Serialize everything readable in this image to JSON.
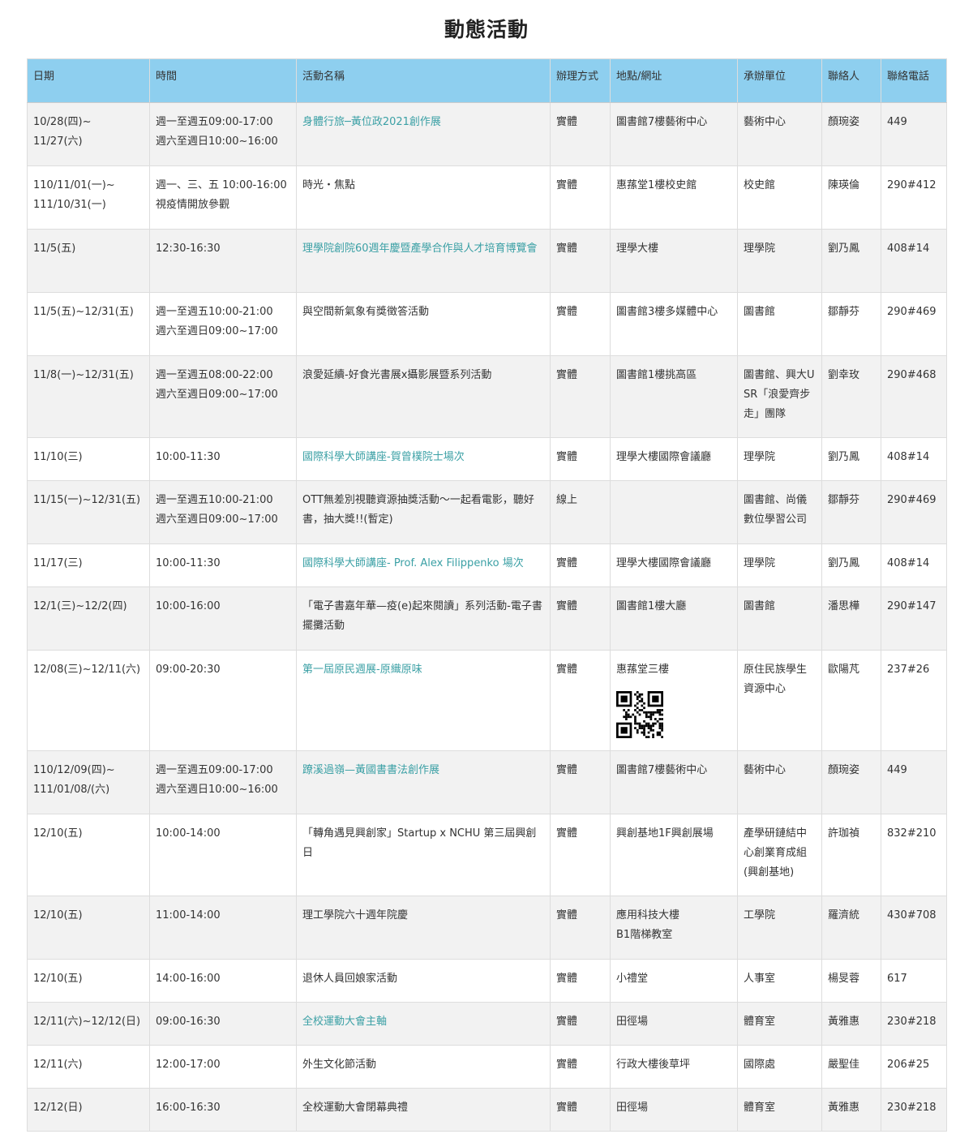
{
  "page": {
    "title": "動態活動"
  },
  "table": {
    "headers": [
      "日期",
      "時間",
      "活動名稱",
      "辦理方式",
      "地點/網址",
      "承辦單位",
      "聯絡人",
      "聯絡電話"
    ],
    "rows": [
      {
        "date": [
          "10/28(四)~",
          "11/27(六)"
        ],
        "time": [
          "週一至週五09:00-17:00",
          "週六至週日10:00~16:00"
        ],
        "name": "身體行旅─黃位政2021創作展",
        "link": true,
        "mode": "實體",
        "place": [
          "圖書館7樓藝術中心"
        ],
        "unit": "藝術中心",
        "contact": "顏琬姿",
        "phone": "449"
      },
      {
        "date": [
          "110/11/01(一)~",
          "111/10/31(一)"
        ],
        "time": [
          "週一、三、五 10:00-16:00",
          "視疫情開放參觀"
        ],
        "name": "時光・焦點",
        "link": false,
        "mode": "實體",
        "place": [
          "惠蓀堂1樓校史館"
        ],
        "unit": "校史館",
        "contact": "陳瑛倫",
        "phone": "290#412"
      },
      {
        "date": [
          "11/5(五)"
        ],
        "time": [
          "12:30-16:30"
        ],
        "name": "理學院創院60週年慶暨產學合作與人才培育博覽會",
        "link": true,
        "mode": "實體",
        "place": [
          "理學大樓"
        ],
        "unit": "理學院",
        "contact": "劉乃鳳",
        "phone": "408#14"
      },
      {
        "date": [
          "11/5(五)~12/31(五)"
        ],
        "time": [
          "週一至週五10:00-21:00",
          "週六至週日09:00~17:00"
        ],
        "name": "與空間新氣象有獎徵答活動",
        "link": false,
        "mode": "實體",
        "place": [
          "圖書館3樓多媒體中心"
        ],
        "unit": "圖書館",
        "contact": "鄒靜芬",
        "phone": "290#469"
      },
      {
        "date": [
          "11/8(一)~12/31(五)"
        ],
        "time": [
          "週一至週五08:00-22:00",
          "週六至週日09:00~17:00"
        ],
        "name": "浪愛延續-好食光書展x攝影展暨系列活動",
        "link": false,
        "mode": "實體",
        "place": [
          "圖書館1樓挑高區"
        ],
        "unit": "圖書館、興大USR「浪愛齊步走」團隊",
        "contact": "劉幸玫",
        "phone": "290#468"
      },
      {
        "date": [
          "11/10(三)"
        ],
        "time": [
          "10:00-11:30"
        ],
        "name": "國際科學大師講座-賀曾樸院士場次",
        "link": true,
        "mode": "實體",
        "place": [
          "理學大樓國際會議廳"
        ],
        "unit": "理學院",
        "contact": "劉乃鳳",
        "phone": "408#14"
      },
      {
        "date": [
          "11/15(一)~12/31(五)"
        ],
        "time": [
          "週一至週五10:00-21:00",
          "週六至週日09:00~17:00"
        ],
        "name": "OTT無差別視聽資源抽獎活動～一起看電影，聽好書，抽大獎!!(暫定)",
        "link": false,
        "mode": "線上",
        "place": [
          ""
        ],
        "unit": "圖書館、尚儀數位學習公司",
        "contact": "鄒靜芬",
        "phone": "290#469"
      },
      {
        "date": [
          "11/17(三)"
        ],
        "time": [
          "10:00-11:30"
        ],
        "name": "國際科學大師講座- Prof. Alex Filippenko 場次",
        "link": true,
        "mode": "實體",
        "place": [
          "理學大樓國際會議廳"
        ],
        "unit": "理學院",
        "contact": "劉乃鳳",
        "phone": "408#14"
      },
      {
        "date": [
          "12/1(三)~12/2(四)"
        ],
        "time": [
          "10:00-16:00"
        ],
        "name": "「電子書嘉年華—疫(e)起來閱讀」系列活動-電子書擺攤活動",
        "link": false,
        "mode": "實體",
        "place": [
          "圖書館1樓大廳"
        ],
        "unit": "圖書館",
        "contact": "潘思樺",
        "phone": "290#147"
      },
      {
        "date": [
          "12/08(三)~12/11(六)"
        ],
        "time": [
          "09:00-20:30"
        ],
        "name": "第一屆原民週展-原織原味",
        "link": true,
        "mode": "實體",
        "place": [
          "惠蓀堂三樓"
        ],
        "qr": true,
        "unit": "原住民族學生資源中心",
        "contact": "歐陽芃",
        "phone": "237#26"
      },
      {
        "date": [
          "110/12/09(四)~",
          "111/01/08/(六)"
        ],
        "time": [
          "週一至週五09:00-17:00",
          "週六至週日10:00~16:00"
        ],
        "name": "蹽溪過嶺—黃國書書法創作展",
        "link": true,
        "mode": "實體",
        "place": [
          "圖書館7樓藝術中心"
        ],
        "unit": "藝術中心",
        "contact": "顏琬姿",
        "phone": "449"
      },
      {
        "date": [
          "12/10(五)"
        ],
        "time": [
          "10:00-14:00"
        ],
        "name": "「轉角遇見興創家」Startup x NCHU 第三屆興創日",
        "link": false,
        "mode": "實體",
        "place": [
          "興創基地1F興創展場"
        ],
        "unit": "產學研鏈結中心創業育成組(興創基地)",
        "contact": "許珈禎",
        "phone": "832#210"
      },
      {
        "date": [
          "12/10(五)"
        ],
        "time": [
          "11:00-14:00"
        ],
        "name": "理工學院六十週年院慶",
        "link": false,
        "mode": "實體",
        "place": [
          "應用科技大樓",
          "B1階梯教室"
        ],
        "unit": "工學院",
        "contact": "羅濟統",
        "phone": "430#708"
      },
      {
        "date": [
          "12/10(五)"
        ],
        "time": [
          "14:00-16:00"
        ],
        "name": "退休人員回娘家活動",
        "link": false,
        "mode": "實體",
        "place": [
          "小禮堂"
        ],
        "unit": "人事室",
        "contact": "楊旻蓉",
        "phone": "617"
      },
      {
        "date": [
          "12/11(六)~12/12(日)"
        ],
        "time": [
          "09:00-16:30"
        ],
        "name": "全校運動大會主軸",
        "link": true,
        "mode": "實體",
        "place": [
          "田徑場"
        ],
        "unit": "體育室",
        "contact": "黃雅惠",
        "phone": "230#218"
      },
      {
        "date": [
          "12/11(六)"
        ],
        "time": [
          "12:00-17:00"
        ],
        "name": "外生文化節活動",
        "link": false,
        "mode": "實體",
        "place": [
          "行政大樓後草坪"
        ],
        "unit": "國際處",
        "contact": "嚴聖佳",
        "phone": "206#25"
      },
      {
        "date": [
          "12/12(日)"
        ],
        "time": [
          "16:00-16:30"
        ],
        "name": "全校運動大會閉幕典禮",
        "link": false,
        "mode": "實體",
        "place": [
          "田徑場"
        ],
        "unit": "體育室",
        "contact": "黃雅惠",
        "phone": "230#218"
      }
    ]
  }
}
